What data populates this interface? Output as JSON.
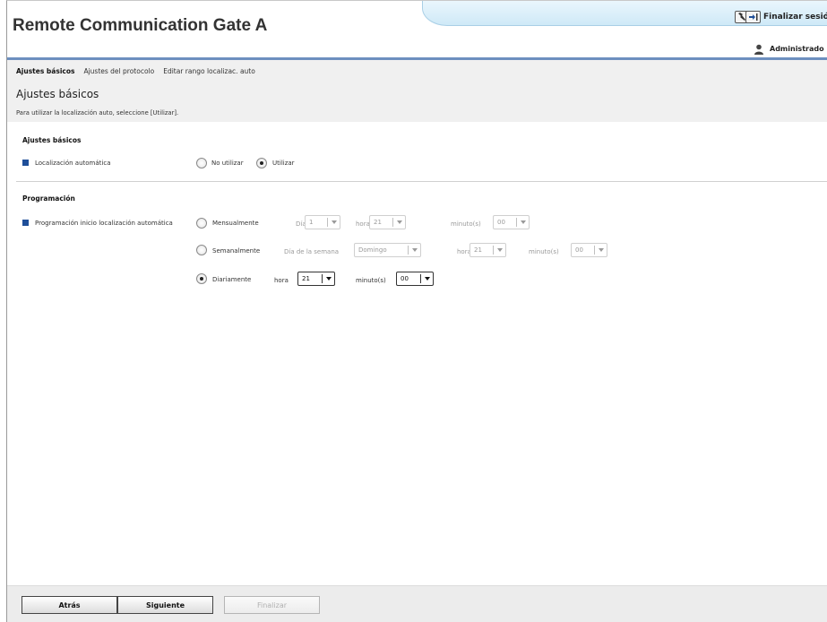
{
  "header": {
    "app_title": "Remote Communication Gate A",
    "logout_label": "Finalizar sesió",
    "user_name": "Administrado",
    "tools": [
      "wrench-icon",
      "logout-arrow-icon"
    ]
  },
  "tabs": [
    {
      "label": "Ajustes básicos",
      "active": true
    },
    {
      "label": "Ajustes del protocolo",
      "active": false
    },
    {
      "label": "Editar rango localizac. auto",
      "active": false
    }
  ],
  "page": {
    "title": "Ajustes básicos",
    "description": "Para utilizar la localización auto, seleccione [Utilizar]."
  },
  "basic_settings": {
    "section_title": "Ajustes básicos",
    "auto_locate": {
      "label": "Localización automática",
      "options": [
        {
          "label": "No utilizar",
          "checked": false
        },
        {
          "label": "Utilizar",
          "checked": true
        }
      ]
    }
  },
  "schedule": {
    "section_title": "Programación",
    "row_label": "Programación inicio localización automática",
    "monthly": {
      "label": "Mensualmente",
      "checked": false,
      "day_label": "Día",
      "day_value": "1",
      "hour_label": "hora",
      "hour_value": "21",
      "minute_label": "minuto(s)",
      "minute_value": "00"
    },
    "weekly": {
      "label": "Semanalmente",
      "checked": false,
      "weekday_label": "Día de la semana",
      "weekday_value": "Domingo",
      "hour_label": "hora",
      "hour_value": "21",
      "minute_label": "minuto(s)",
      "minute_value": "00"
    },
    "daily": {
      "label": "Diariamente",
      "checked": true,
      "hour_label": "hora",
      "hour_value": "21",
      "minute_label": "minuto(s)",
      "minute_value": "00"
    }
  },
  "footer": {
    "back_label": "Atrás",
    "next_label": "Siguiente",
    "finish_label": "Finalizar",
    "finish_enabled": false
  },
  "colors": {
    "accent": "#1f4f99",
    "header_line": "#6d8fbf",
    "header_tab": "#d6edf9"
  }
}
